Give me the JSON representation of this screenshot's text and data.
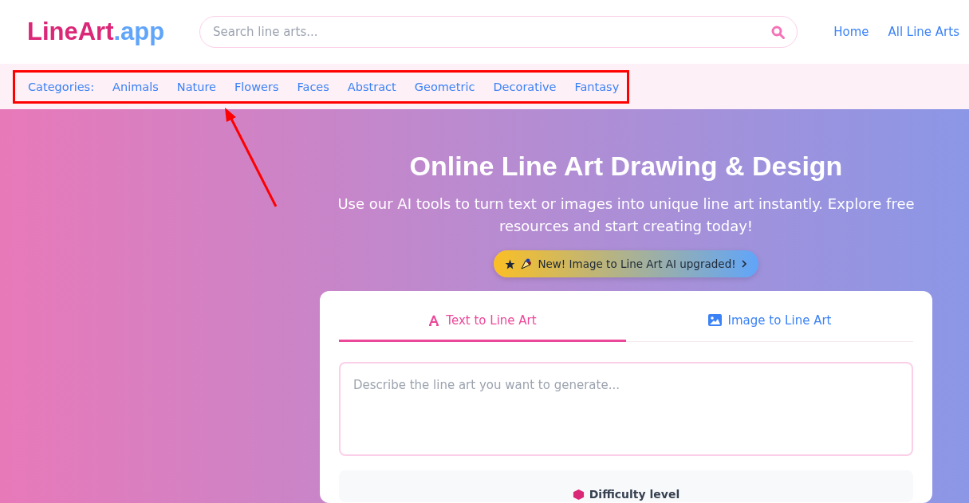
{
  "logo": {
    "main": "LineArt",
    "suffix": ".app"
  },
  "search": {
    "placeholder": "Search line arts..."
  },
  "nav": [
    {
      "label": "Home"
    },
    {
      "label": "All Line Arts"
    }
  ],
  "categories": {
    "label": "Categories:",
    "items": [
      "Animals",
      "Nature",
      "Flowers",
      "Faces",
      "Abstract",
      "Geometric",
      "Decorative",
      "Fantasy"
    ]
  },
  "hero": {
    "title": "Online Line Art Drawing & Design",
    "subtitle": "Use our AI tools to turn text or images into unique line art instantly. Explore free resources and start creating today!",
    "badge": "New! Image to Line Art AI upgraded!"
  },
  "tabs": [
    {
      "label": "Text to Line Art",
      "kind": "text",
      "selected": true
    },
    {
      "label": "Image to Line Art",
      "kind": "image",
      "selected": false
    }
  ],
  "prompt": {
    "placeholder": "Describe the line art you want to generate..."
  },
  "options": {
    "label": "Difficulty level"
  }
}
